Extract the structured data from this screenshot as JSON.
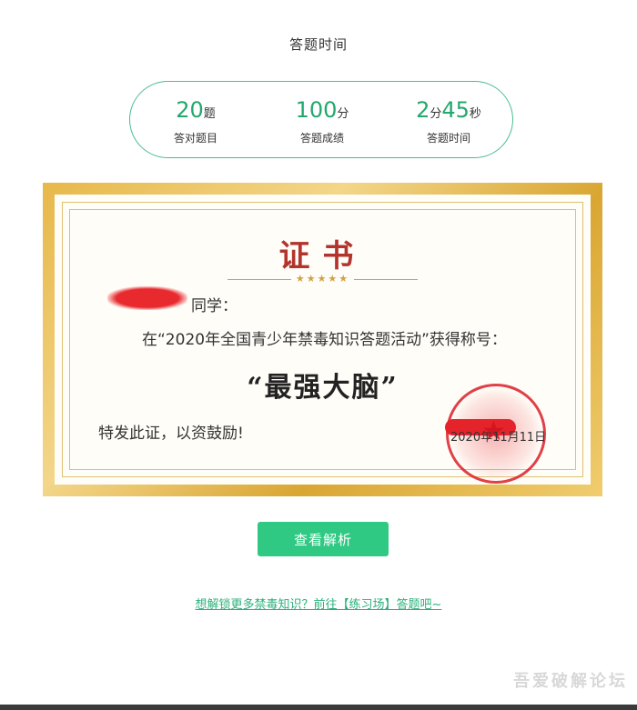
{
  "header": {
    "title": "答题时间"
  },
  "stats": [
    {
      "value": "20",
      "unit": "题",
      "caption": "答对题目"
    },
    {
      "value": "100",
      "unit": "分",
      "caption": "答题成绩"
    },
    {
      "value_min": "2",
      "unit_min": "分",
      "value_sec": "45",
      "unit_sec": "秒",
      "caption": "答题时间"
    }
  ],
  "certificate": {
    "title": "证书",
    "stars": "★★★★★",
    "greeting_suffix": "同学：",
    "body": "在“2020年全国青少年禁毒知识答题活动”获得称号：",
    "award": "“最强大脑”",
    "closing": "特发此证，以资鼓励!",
    "date": "2020年11月11日"
  },
  "actions": {
    "view_analysis": "查看解析",
    "practice_link": "想解锁更多禁毒知识？前往【练习场】答题吧~"
  },
  "watermark": "吾爱破解论坛",
  "colors": {
    "accent": "#2fc983",
    "cert_gold": "#e7b84a",
    "cert_title_red": "#b3342d",
    "redaction_red": "#e8292e"
  }
}
